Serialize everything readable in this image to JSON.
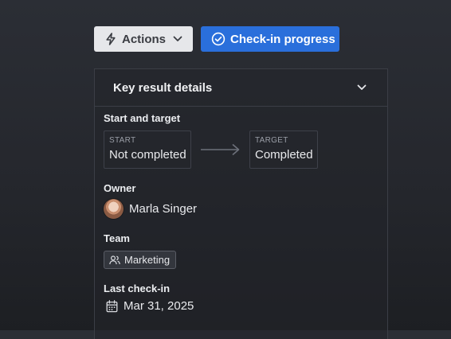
{
  "toolbar": {
    "actions_label": "Actions",
    "checkin_label": "Check-in progress"
  },
  "panel": {
    "title": "Key result details",
    "start_and_target": {
      "label": "Start and target",
      "start": {
        "caption": "START",
        "value": "Not completed"
      },
      "target": {
        "caption": "TARGET",
        "value": "Completed"
      }
    },
    "owner": {
      "label": "Owner",
      "name": "Marla Singer"
    },
    "team": {
      "label": "Team",
      "name": "Marketing"
    },
    "last_checkin": {
      "label": "Last check-in",
      "date": "Mar 31, 2025"
    }
  },
  "icons": {
    "actions": "lightning-icon",
    "actions_menu": "chevron-down-icon",
    "checkin": "check-circle-icon",
    "collapse": "chevron-down-icon",
    "arrow": "arrow-right-icon",
    "team": "users-icon",
    "date": "calendar-icon"
  },
  "colors": {
    "primary": "#2a6fdb",
    "secondary_button": "#e6e7ea",
    "background": "#25272d",
    "border": "#3b3e46"
  }
}
